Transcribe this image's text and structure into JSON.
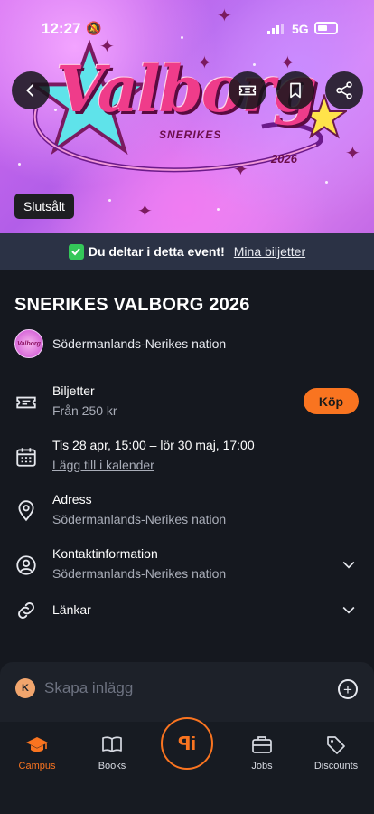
{
  "status_bar": {
    "time": "12:27",
    "network": "5G"
  },
  "hero": {
    "logo_text": "Valborg",
    "logo_sub": "SNERIKES",
    "logo_year": "2026",
    "sold_out_label": "Slutsålt"
  },
  "attendance": {
    "message": "Du deltar i detta event!",
    "link": "Mina biljetter"
  },
  "event": {
    "title": "SNERIKES VALBORG 2026",
    "organizer": "Södermanlands-Nerikes nation",
    "organizer_avatar_text": "Valborg"
  },
  "details": {
    "tickets": {
      "label": "Biljetter",
      "value": "Från 250 kr",
      "buy_label": "Köp"
    },
    "date": {
      "label": "Tis 28 apr, 15:00 – lör 30 maj, 17:00",
      "value": "Lägg till i kalender"
    },
    "address": {
      "label": "Adress",
      "value": "Södermanlands-Nerikes nation"
    },
    "contact": {
      "label": "Kontaktinformation",
      "value": "Södermanlands-Nerikes nation"
    },
    "links": {
      "label": "Länkar"
    }
  },
  "composer": {
    "avatar_letter": "K",
    "placeholder": "Skapa inlägg"
  },
  "nav": {
    "campus": "Campus",
    "books": "Books",
    "center": "ꟼi",
    "jobs": "Jobs",
    "discounts": "Discounts"
  },
  "colors": {
    "accent": "#f97420",
    "background": "#15181f",
    "banner_bar": "#2b3245"
  },
  "icons": [
    "back-icon",
    "ticket-icon",
    "bookmark-icon",
    "share-icon",
    "calendar-icon",
    "location-icon",
    "contact-icon",
    "link-icon",
    "chevron-down-icon",
    "plus-icon",
    "graduation-cap-icon",
    "book-icon",
    "briefcase-icon",
    "tag-icon"
  ]
}
